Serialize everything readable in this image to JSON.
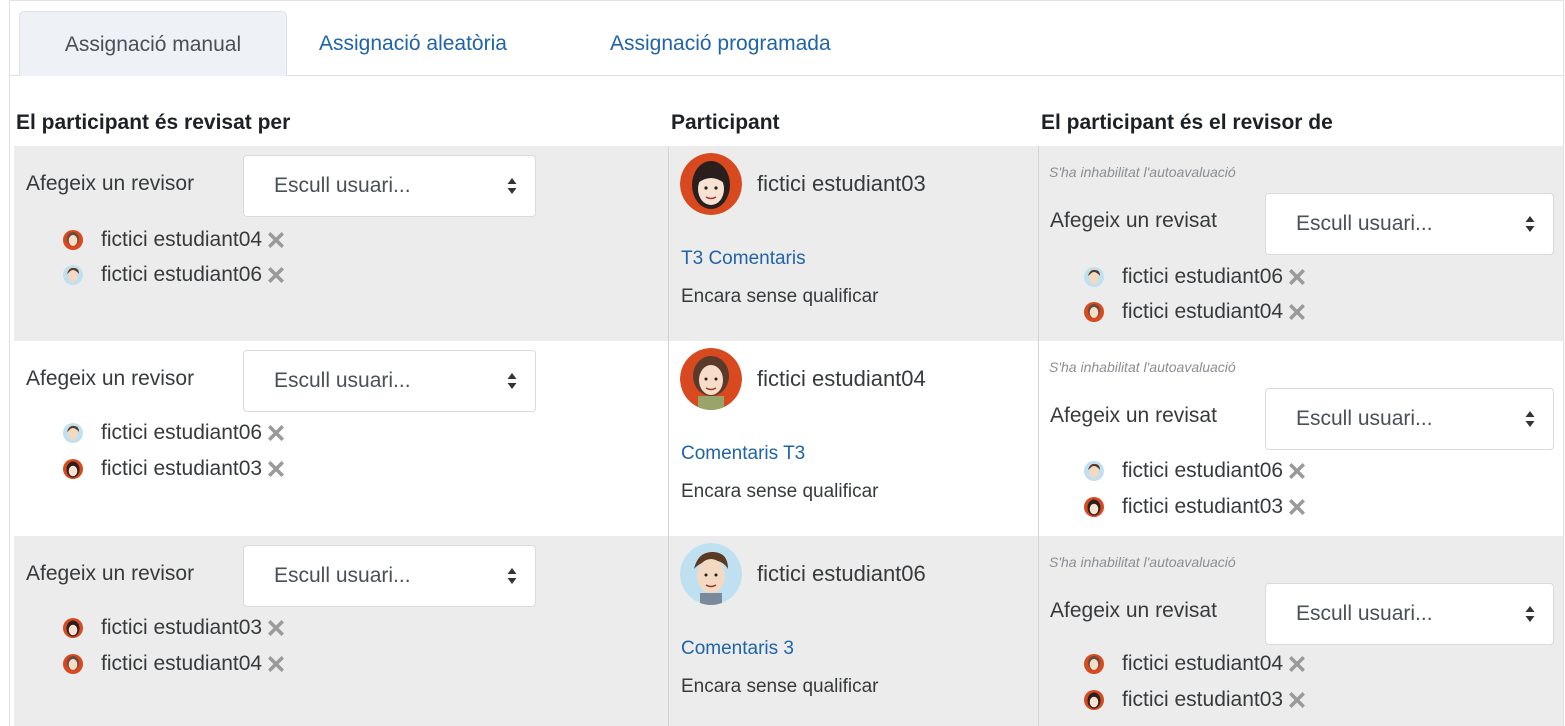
{
  "tabs": [
    {
      "label": "Assignació manual"
    },
    {
      "label": "Assignació aleatòria"
    },
    {
      "label": "Assignació programada"
    }
  ],
  "headers": {
    "reviewed_by": "El participant és revisat per",
    "participant": "Participant",
    "reviewer_of": "El participant és el revisor de"
  },
  "labels": {
    "add_reviewer": "Afegeix un revisor",
    "add_reviewee": "Afegeix un revisat",
    "select_placeholder": "Escull usuari...",
    "self_assessment_disabled": "S'ha inhabilitat l'autoavaluació",
    "no_grade": "Encara sense qualificar"
  },
  "rows": [
    {
      "participant": "fictici estudiant03",
      "submission_title": "T3 Comentaris",
      "reviewers": [
        {
          "name": "fictici estudiant04",
          "avatar_icon": "user-avatar-icon"
        },
        {
          "name": "fictici estudiant06",
          "avatar_icon": "user-avatar-icon"
        }
      ],
      "reviewees": [
        {
          "name": "fictici estudiant06",
          "avatar_icon": "user-avatar-icon"
        },
        {
          "name": "fictici estudiant04",
          "avatar_icon": "user-avatar-icon"
        }
      ]
    },
    {
      "participant": "fictici estudiant04",
      "submission_title": "Comentaris T3",
      "reviewers": [
        {
          "name": "fictici estudiant06",
          "avatar_icon": "user-avatar-icon"
        },
        {
          "name": "fictici estudiant03",
          "avatar_icon": "user-avatar-icon"
        }
      ],
      "reviewees": [
        {
          "name": "fictici estudiant06",
          "avatar_icon": "user-avatar-icon"
        },
        {
          "name": "fictici estudiant03",
          "avatar_icon": "user-avatar-icon"
        }
      ]
    },
    {
      "participant": "fictici estudiant06",
      "submission_title": "Comentaris 3",
      "reviewers": [
        {
          "name": "fictici estudiant03",
          "avatar_icon": "user-avatar-icon"
        },
        {
          "name": "fictici estudiant04",
          "avatar_icon": "user-avatar-icon"
        }
      ],
      "reviewees": [
        {
          "name": "fictici estudiant04",
          "avatar_icon": "user-avatar-icon"
        },
        {
          "name": "fictici estudiant03",
          "avatar_icon": "user-avatar-icon"
        }
      ]
    }
  ],
  "colors": {
    "link": "#1f64a8",
    "row_alt": "#ececec",
    "tab_active_bg": "#eef1f5",
    "remove_icon": "#999999"
  },
  "icons": {
    "remove": "close-x-icon",
    "select": "sort-arrows-icon"
  }
}
